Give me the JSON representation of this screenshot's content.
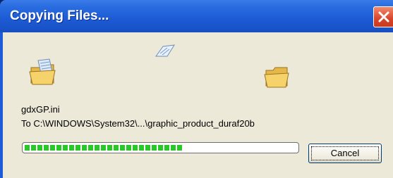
{
  "window": {
    "title": "Copying Files...",
    "close_icon": "close-x-icon"
  },
  "animation": {
    "source_icon": "folder-with-paper-icon",
    "flying_icon": "paper-sheet-icon",
    "destination_icon": "folder-icon"
  },
  "copy": {
    "filename": "gdxGP.ini",
    "destination": "To C:\\WINDOWS\\System32\\...\\graphic_product_duraf20b",
    "progress_fraction": 0.58
  },
  "buttons": {
    "cancel_label": "Cancel"
  },
  "colors": {
    "titlebar": "#1d5cd6",
    "client_bg": "#ECE9D8",
    "progress": "#28c828",
    "close_button": "#d9452a"
  }
}
